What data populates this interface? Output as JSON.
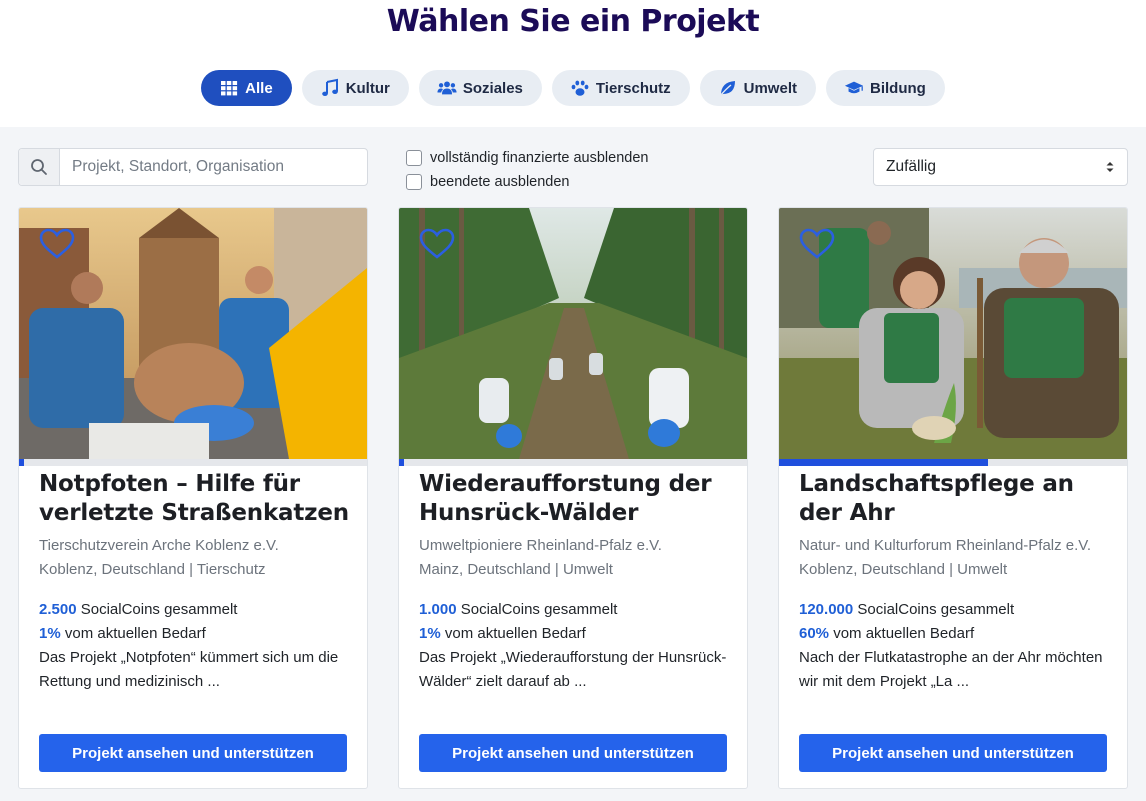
{
  "title": "Wählen Sie ein Projekt",
  "filters": [
    {
      "label": "Alle",
      "icon": "grid-icon",
      "active": true
    },
    {
      "label": "Kultur",
      "icon": "music-icon",
      "active": false
    },
    {
      "label": "Soziales",
      "icon": "users-icon",
      "active": false
    },
    {
      "label": "Tierschutz",
      "icon": "paw-icon",
      "active": false
    },
    {
      "label": "Umwelt",
      "icon": "leaf-icon",
      "active": false
    },
    {
      "label": "Bildung",
      "icon": "graduation-cap-icon",
      "active": false
    }
  ],
  "search": {
    "placeholder": "Projekt, Standort, Organisation",
    "icon": "search-icon"
  },
  "checkboxes": [
    {
      "label": "vollständig finanzierte ausblenden",
      "checked": false
    },
    {
      "label": "beendete ausblenden",
      "checked": false
    }
  ],
  "sort": {
    "value": "Zufällig"
  },
  "accent_color": "#2563eb",
  "cards": [
    {
      "title": "Notpfoten – Hilfe für verletzte Straßenkatzen",
      "organization": "Tierschutzverein Arche Koblenz e.V.",
      "location_category": "Koblenz, Deutschland | Tierschutz",
      "coins": "2.500",
      "coins_suffix": "SocialCoins gesammelt",
      "percent": "1%",
      "percent_suffix": "vom aktuellen Bedarf",
      "progress": 0.01,
      "description": "Das Projekt „Notpfoten“ kümmert sich um die Rettung und medizinisch ...",
      "button": "Projekt ansehen und unterstützen"
    },
    {
      "title": "Wiederaufforstung der Hunsrück-Wälder",
      "organization": "Umweltpioniere Rheinland-Pfalz e.V.",
      "location_category": "Mainz, Deutschland | Umwelt",
      "coins": "1.000",
      "coins_suffix": "SocialCoins gesammelt",
      "percent": "1%",
      "percent_suffix": "vom aktuellen Bedarf",
      "progress": 0.01,
      "description": "Das Projekt „Wiederaufforstung der Hunsrück-Wälder“ zielt darauf ab ...",
      "button": "Projekt ansehen und unterstützen"
    },
    {
      "title": "Landschaftspflege an der Ahr",
      "organization": "Natur- und Kulturforum Rheinland-Pfalz e.V.",
      "location_category": "Koblenz, Deutschland | Umwelt",
      "coins": "120.000",
      "coins_suffix": "SocialCoins gesammelt",
      "percent": "60%",
      "percent_suffix": "vom aktuellen Bedarf",
      "progress": 0.6,
      "description": "Nach der Flutkatastrophe an der Ahr möchten wir mit dem Projekt „La ...",
      "button": "Projekt ansehen und unterstützen"
    }
  ]
}
